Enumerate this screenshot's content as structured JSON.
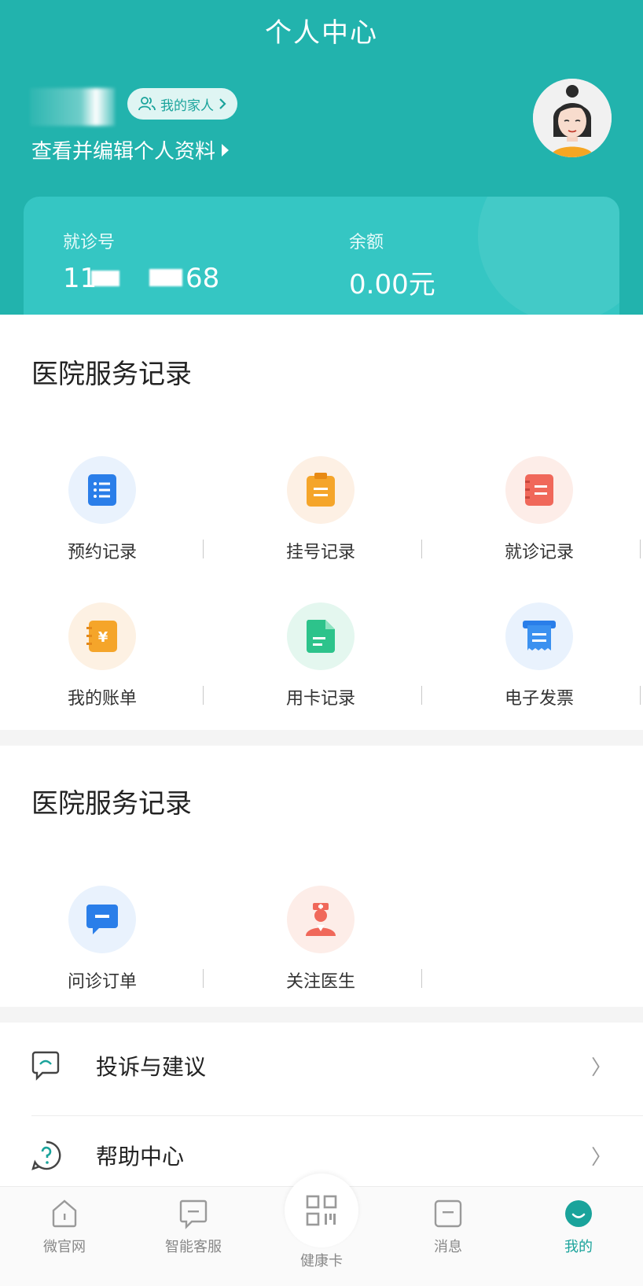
{
  "header": {
    "title": "个人中心",
    "family_button": "我的家人",
    "edit_profile": "查看并编辑个人资料"
  },
  "card": {
    "visit_label": "就诊号",
    "visit_prefix": "11",
    "visit_suffix": "68",
    "balance_label": "余额",
    "balance_value": "0.00元"
  },
  "records_section": {
    "title": "医院服务记录",
    "items": [
      {
        "label": "预约记录",
        "icon": "appointment-list-icon"
      },
      {
        "label": "挂号记录",
        "icon": "clipboard-icon"
      },
      {
        "label": "就诊记录",
        "icon": "notebook-icon"
      },
      {
        "label": "我的账单",
        "icon": "yuan-book-icon"
      },
      {
        "label": "用卡记录",
        "icon": "document-icon"
      },
      {
        "label": "电子发票",
        "icon": "receipt-icon"
      }
    ]
  },
  "consult_section": {
    "title": "医院服务记录",
    "items": [
      {
        "label": "问诊订单",
        "icon": "chat-icon"
      },
      {
        "label": "关注医生",
        "icon": "nurse-icon"
      }
    ]
  },
  "list": [
    {
      "label": "投诉与建议",
      "icon": "feedback-icon"
    },
    {
      "label": "帮助中心",
      "icon": "help-icon"
    }
  ],
  "tabs": [
    {
      "label": "微官网",
      "icon": "home-icon"
    },
    {
      "label": "智能客服",
      "icon": "service-chat-icon"
    },
    {
      "label": "健康卡",
      "icon": "qr-code-icon"
    },
    {
      "label": "消息",
      "icon": "message-icon"
    },
    {
      "label": "我的",
      "icon": "profile-icon",
      "active": true
    }
  ],
  "colors": {
    "primary": "#22b3ad",
    "card": "#35c6c3",
    "active_tab": "#1aa39b"
  }
}
